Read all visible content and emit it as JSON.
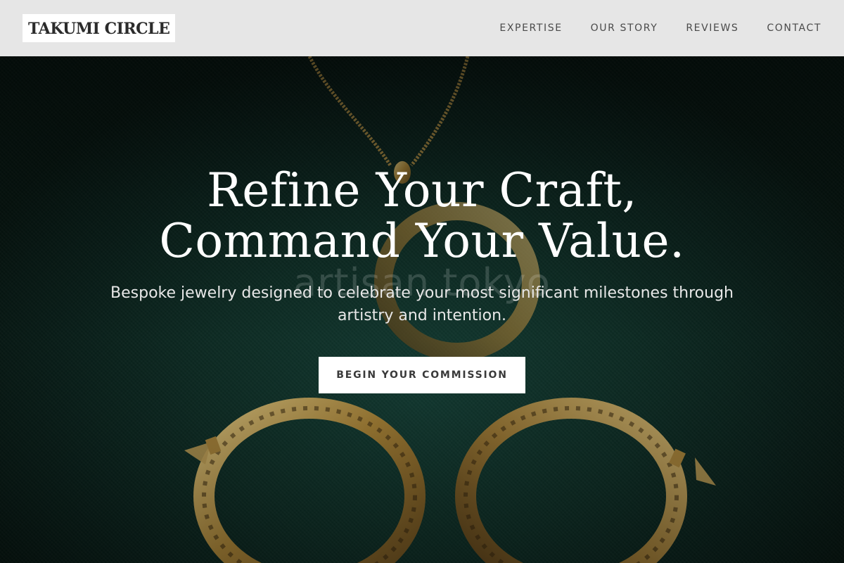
{
  "header": {
    "logo": "TAKUMI CIRCLE",
    "nav": [
      {
        "label": "EXPERTISE"
      },
      {
        "label": "OUR STORY"
      },
      {
        "label": "REVIEWS"
      },
      {
        "label": "CONTACT"
      }
    ]
  },
  "hero": {
    "title_line1": "Refine Your Craft,",
    "title_line2": "Command Your Value.",
    "subtitle": "Bespoke jewelry designed to celebrate your most significant milestones through artistry and intention.",
    "cta_label": "BEGIN YOUR COMMISSION",
    "watermark": "artisan tokyo",
    "background_image": "gold-jewelry-on-green-fabric"
  },
  "colors": {
    "header_bg": "#e6e6e6",
    "hero_fabric": "#15443a",
    "gold": "#c9a24a",
    "cta_bg": "#ffffff",
    "cta_text": "#3a3a3a"
  }
}
